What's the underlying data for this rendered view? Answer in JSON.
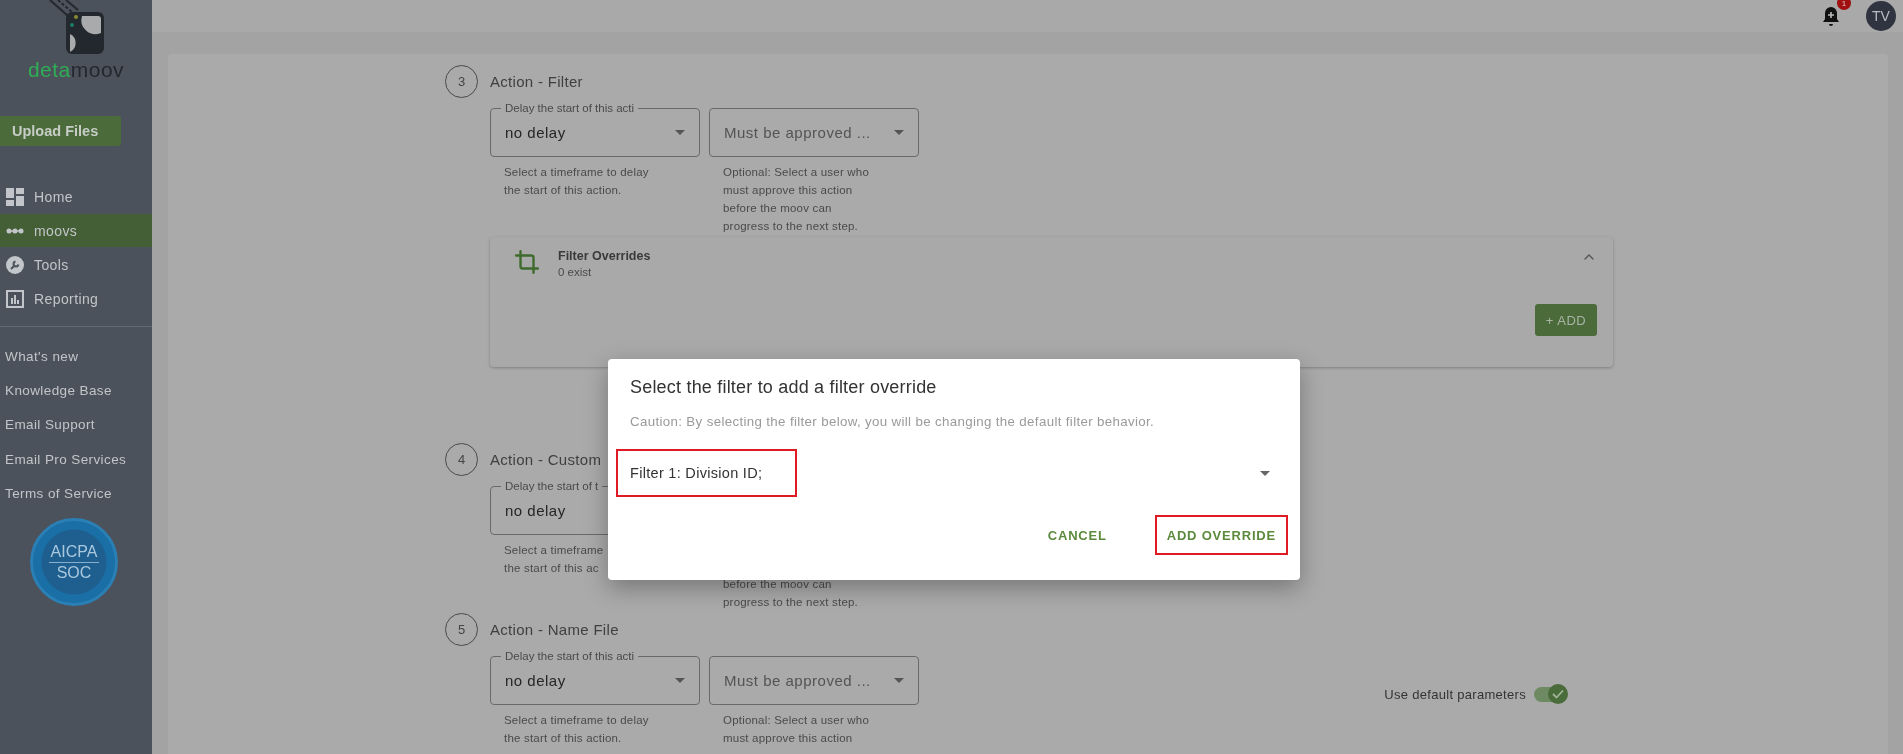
{
  "logo": {
    "first": "deta",
    "second": "moov"
  },
  "sidebar": {
    "upload_button": "Upload Files",
    "nav": [
      {
        "label": "Home",
        "selected": false
      },
      {
        "label": "moovs",
        "selected": true
      },
      {
        "label": "Tools",
        "selected": false
      },
      {
        "label": "Reporting",
        "selected": false
      }
    ],
    "links": [
      "What's new",
      "Knowledge Base",
      "Email Support",
      "Email Pro Services",
      "Terms of Service"
    ],
    "badge": {
      "top": "AICPA",
      "bottom": "SOC"
    }
  },
  "header": {
    "notification_count": "1",
    "avatar": "TV"
  },
  "steps": [
    {
      "number": "3",
      "title": "Action - Filter",
      "fields": [
        {
          "kind": "delay",
          "label": "Delay the start of this acti",
          "value": "no delay",
          "helper": [
            "Select a timeframe to delay",
            "the start of this action."
          ]
        },
        {
          "kind": "approver",
          "placeholder": "Must be approved ...",
          "covered": false,
          "helper": [
            "Optional: Select a user who",
            "must approve this action",
            "before the moov can",
            "progress to the next step."
          ]
        }
      ],
      "overrides": {
        "title": "Filter Overrides",
        "count": "0 exist",
        "expanded": true,
        "add_button": "+ ADD"
      }
    },
    {
      "number": "4",
      "title": "Action - Custom",
      "fields": [
        {
          "kind": "delay",
          "label": "Delay the start of t",
          "value": "no delay",
          "helper": [
            "Select a timeframe",
            "the start of this ac"
          ]
        },
        {
          "kind": "approver",
          "covered": true,
          "helper": [
            "before the moov can",
            "progress to the next step."
          ]
        }
      ]
    },
    {
      "number": "5",
      "title": "Action - Name File",
      "fields": [
        {
          "kind": "delay",
          "label": "Delay the start of this acti",
          "value": "no delay",
          "helper": [
            "Select a timeframe to delay",
            "the start of this action."
          ]
        },
        {
          "kind": "approver",
          "placeholder": "Must be approved ...",
          "covered": false,
          "helper": [
            "Optional: Select a user who",
            "must approve this action"
          ]
        }
      ],
      "default_parameters": {
        "label": "Use default parameters",
        "on": true
      }
    }
  ],
  "dialog": {
    "title": "Select the filter to add a filter override",
    "caution": "Caution: By selecting the filter below, you will be changing the default filter behavior.",
    "select": {
      "value": "Filter 1: Division ID;",
      "highlighted": true
    },
    "buttons": [
      {
        "label": "CANCEL",
        "highlighted": false
      },
      {
        "label": "ADD OVERRIDE",
        "highlighted": true
      }
    ]
  }
}
